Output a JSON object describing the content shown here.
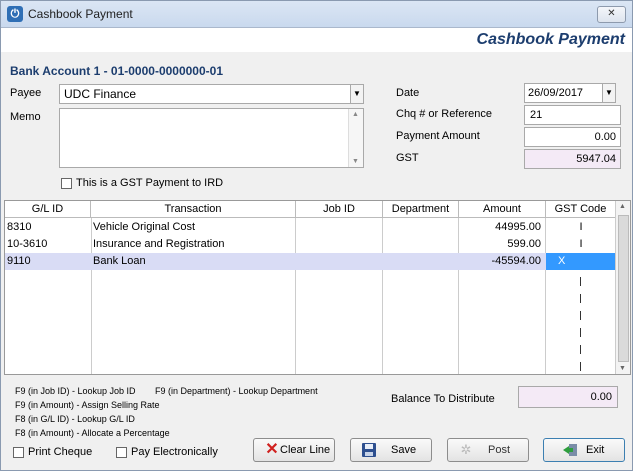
{
  "window": {
    "title": "Cashbook Payment",
    "form_title": "Cashbook Payment",
    "close_glyph": "✕"
  },
  "bank_account": "Bank Account 1 - 01-0000-0000000-01",
  "payee": {
    "label": "Payee",
    "value": "UDC Finance"
  },
  "memo": {
    "label": "Memo",
    "value": ""
  },
  "gst_ird": {
    "label": "This is a GST Payment to IRD",
    "checked": false
  },
  "date": {
    "label": "Date",
    "value": "26/09/2017"
  },
  "reference": {
    "label": "Chq # or Reference",
    "value": "21"
  },
  "payment_amount": {
    "label": "Payment Amount",
    "value": "0.00"
  },
  "gst": {
    "label": "GST",
    "value": "5947.04"
  },
  "grid": {
    "columns": [
      "G/L ID",
      "Transaction",
      "Job ID",
      "Department",
      "Amount",
      "GST Code"
    ],
    "rows": [
      {
        "gl_id": "8310",
        "transaction": "Vehicle Original Cost",
        "job_id": "",
        "department": "",
        "amount": "44995.00",
        "gst_code": "I"
      },
      {
        "gl_id": "10-3610",
        "transaction": "Insurance and Registration",
        "job_id": "",
        "department": "",
        "amount": "599.00",
        "gst_code": "I"
      },
      {
        "gl_id": "9110",
        "transaction": "Bank Loan",
        "job_id": "",
        "department": "",
        "amount": "-45594.00",
        "gst_code": "X"
      }
    ],
    "selected_row": 2
  },
  "help": {
    "line1a": "F9 (in Job ID) - Lookup Job ID",
    "line1b": "F9 (in Department) - Lookup Department",
    "line2": "F9 (in Amount) - Assign Selling Rate",
    "line3": "F8 (in G/L ID) - Lookup G/L ID",
    "line4": "F8 (in Amount) - Allocate a Percentage"
  },
  "balance": {
    "label": "Balance To Distribute",
    "value": "0.00"
  },
  "options": {
    "print_cheque": "Print Cheque",
    "pay_electronically": "Pay Electronically"
  },
  "buttons": {
    "clear_line": "Clear Line",
    "save": "Save",
    "post": "Post",
    "exit": "Exit"
  },
  "colors": {
    "accent": "#1c3d6e",
    "selected_row": "#d9dcf5",
    "selected_cell": "#3399ff"
  }
}
